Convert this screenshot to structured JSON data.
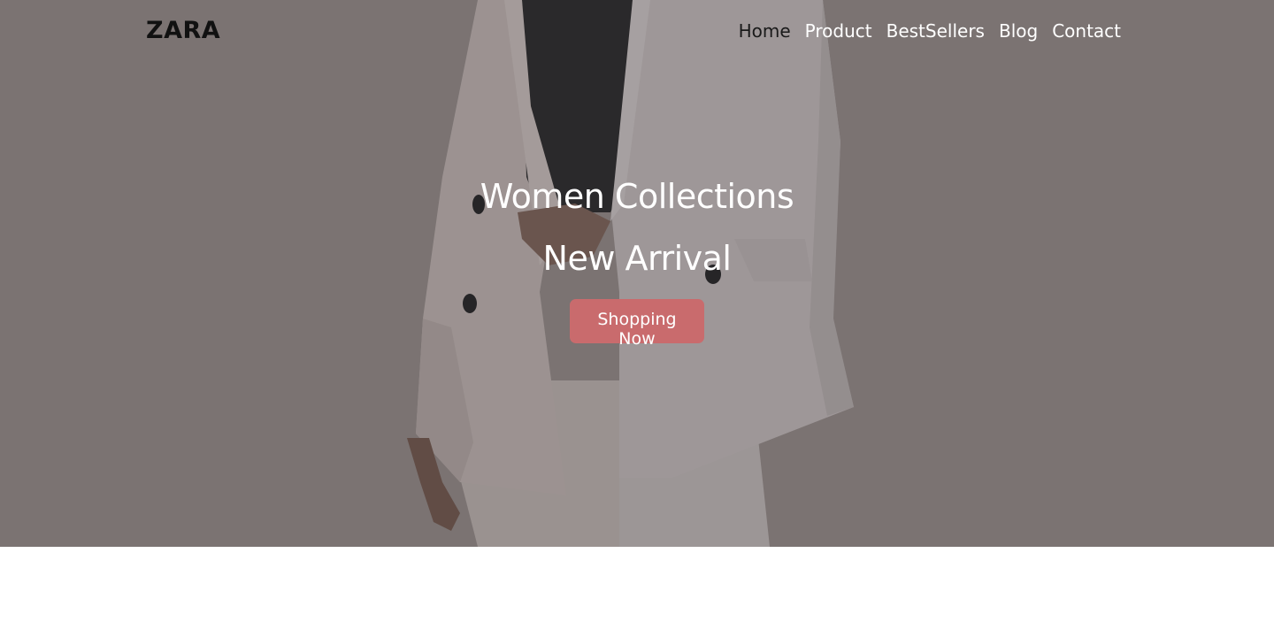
{
  "brand": {
    "logo_text": "ZARA"
  },
  "nav": {
    "items": [
      {
        "label": "Home",
        "active": true
      },
      {
        "label": "Product"
      },
      {
        "label": "BestSellers"
      },
      {
        "label": "Blog"
      },
      {
        "label": "Contact"
      }
    ]
  },
  "hero": {
    "title": "Women Collections",
    "subtitle": "New Arrival",
    "cta_label": "Shopping Now",
    "image": "woman-in-white-blazer-photo",
    "colors": {
      "accent": "#c96b6d",
      "overlay": "#7d7474",
      "text": "#ffffff"
    }
  }
}
